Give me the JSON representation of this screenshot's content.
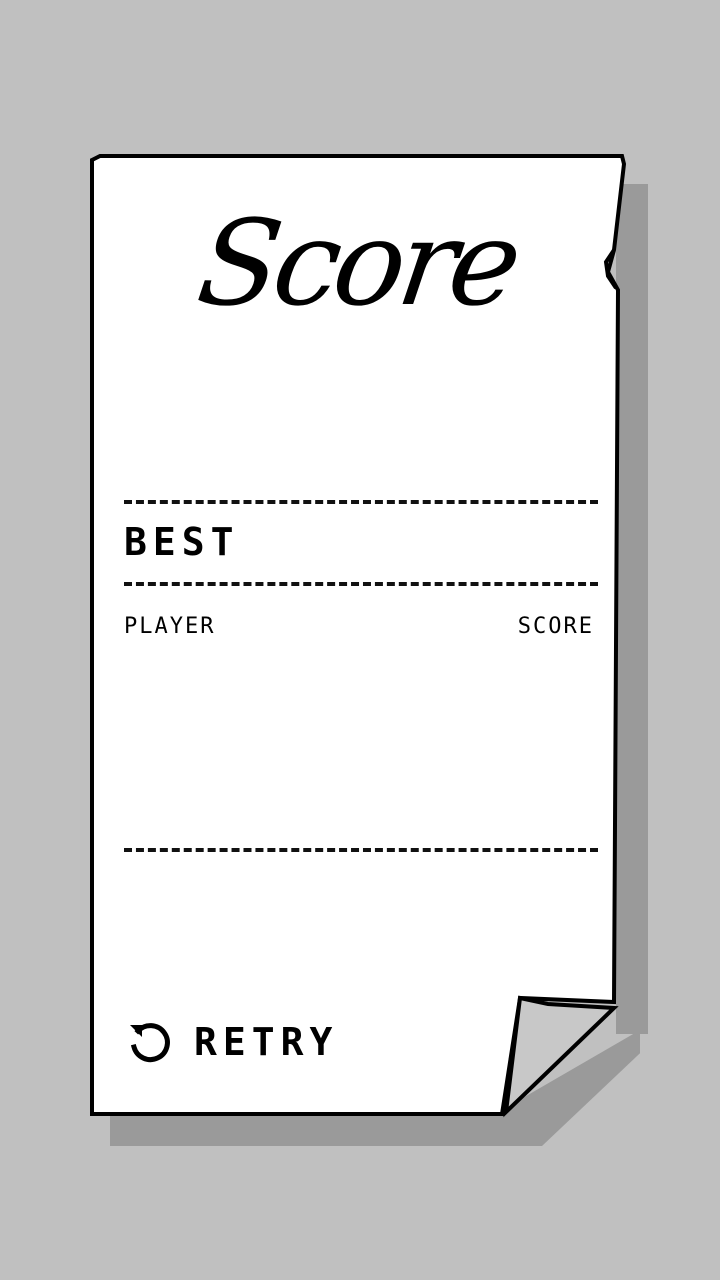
{
  "scorecard": {
    "title": "Score",
    "best_label": "BEST",
    "columns": {
      "player": "PLAYER",
      "score": "SCORE"
    },
    "rows": [],
    "retry_label": "RETRY",
    "retry_icon": "retry-arrow-icon"
  },
  "colors": {
    "background": "#c0c0c0",
    "paper": "#ffffff",
    "ink": "#000000",
    "shadow": "#9a9a9a",
    "fold": "#c8c8c8"
  }
}
